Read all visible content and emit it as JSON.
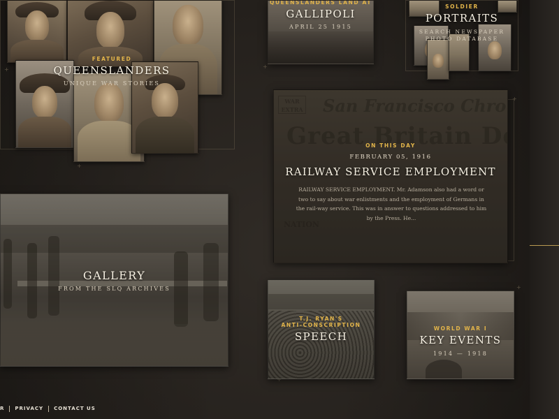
{
  "tiles": {
    "gallipoli": {
      "kicker": "QUEENSLANDERS LAND AT",
      "title": "GALLIPOLI",
      "subtitle": "APRIL 25 1915"
    },
    "portraits": {
      "kicker": "SOLDIER",
      "title": "PORTRAITS",
      "subtitle_line1": "SEARCH NEWSPAPER",
      "subtitle_line2": "PHOTO DATABASE"
    },
    "queenslanders": {
      "kicker": "FEATURED",
      "title": "QUEENSLANDERS",
      "subtitle": "UNIQUE WAR STORIES"
    },
    "on_this_day": {
      "kicker": "ON THIS DAY",
      "date": "FEBRUARY 05, 1916",
      "title": "RAILWAY SERVICE EMPLOYMENT",
      "excerpt": "RAILWAY SERVICE EMPLOYMENT. Mr. Adamson also had a word or two to say about war enlistments and the employment of Germans in the rail-way service. This was in answer to questions addressed to him by the Press. He...",
      "newspaper_masthead": "San Francisco Chronicle",
      "newspaper_headline": "Great Britain Declares",
      "newspaper_extra": "WAR EXTRA",
      "newspaper_side": "NATION"
    },
    "gallery": {
      "title": "GALLERY",
      "subtitle": "FROM THE SLQ ARCHIVES"
    },
    "speech": {
      "kicker_line1": "T.J. RYAN'S",
      "kicker_line2": "ANTI-CONSCRIPTION",
      "title": "SPEECH"
    },
    "key_events": {
      "kicker": "WORLD WAR I",
      "title": "KEY EVENTS",
      "subtitle": "1914 — 1918"
    }
  },
  "footer": {
    "items": [
      "R",
      "PRIVACY",
      "CONTACT US"
    ]
  },
  "colors": {
    "accent_gold": "#e3b54a",
    "background": "#2a2622",
    "title_text": "#f6f0e2"
  }
}
